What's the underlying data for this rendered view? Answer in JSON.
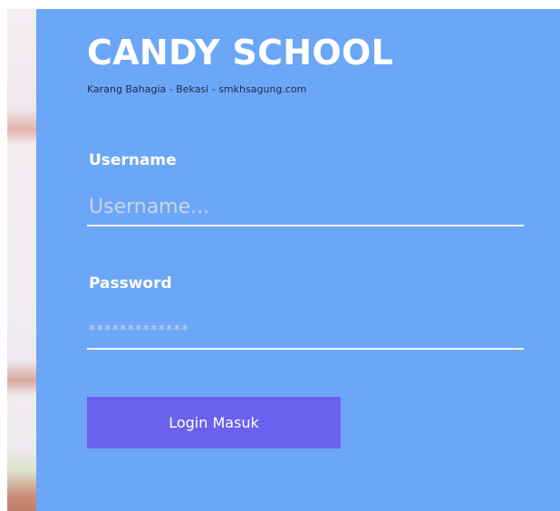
{
  "header": {
    "title": "CANDY SCHOOL",
    "subtitle": "Karang Bahagia - Bekasi - smkhsagung.com"
  },
  "form": {
    "username": {
      "label": "Username",
      "placeholder": "Username...",
      "value": ""
    },
    "password": {
      "label": "Password",
      "placeholder": "*************",
      "value": ""
    },
    "submit_label": "Login Masuk"
  },
  "colors": {
    "panel": "#6ca6f7",
    "button": "#6a62ee",
    "text": "#ffffff"
  }
}
